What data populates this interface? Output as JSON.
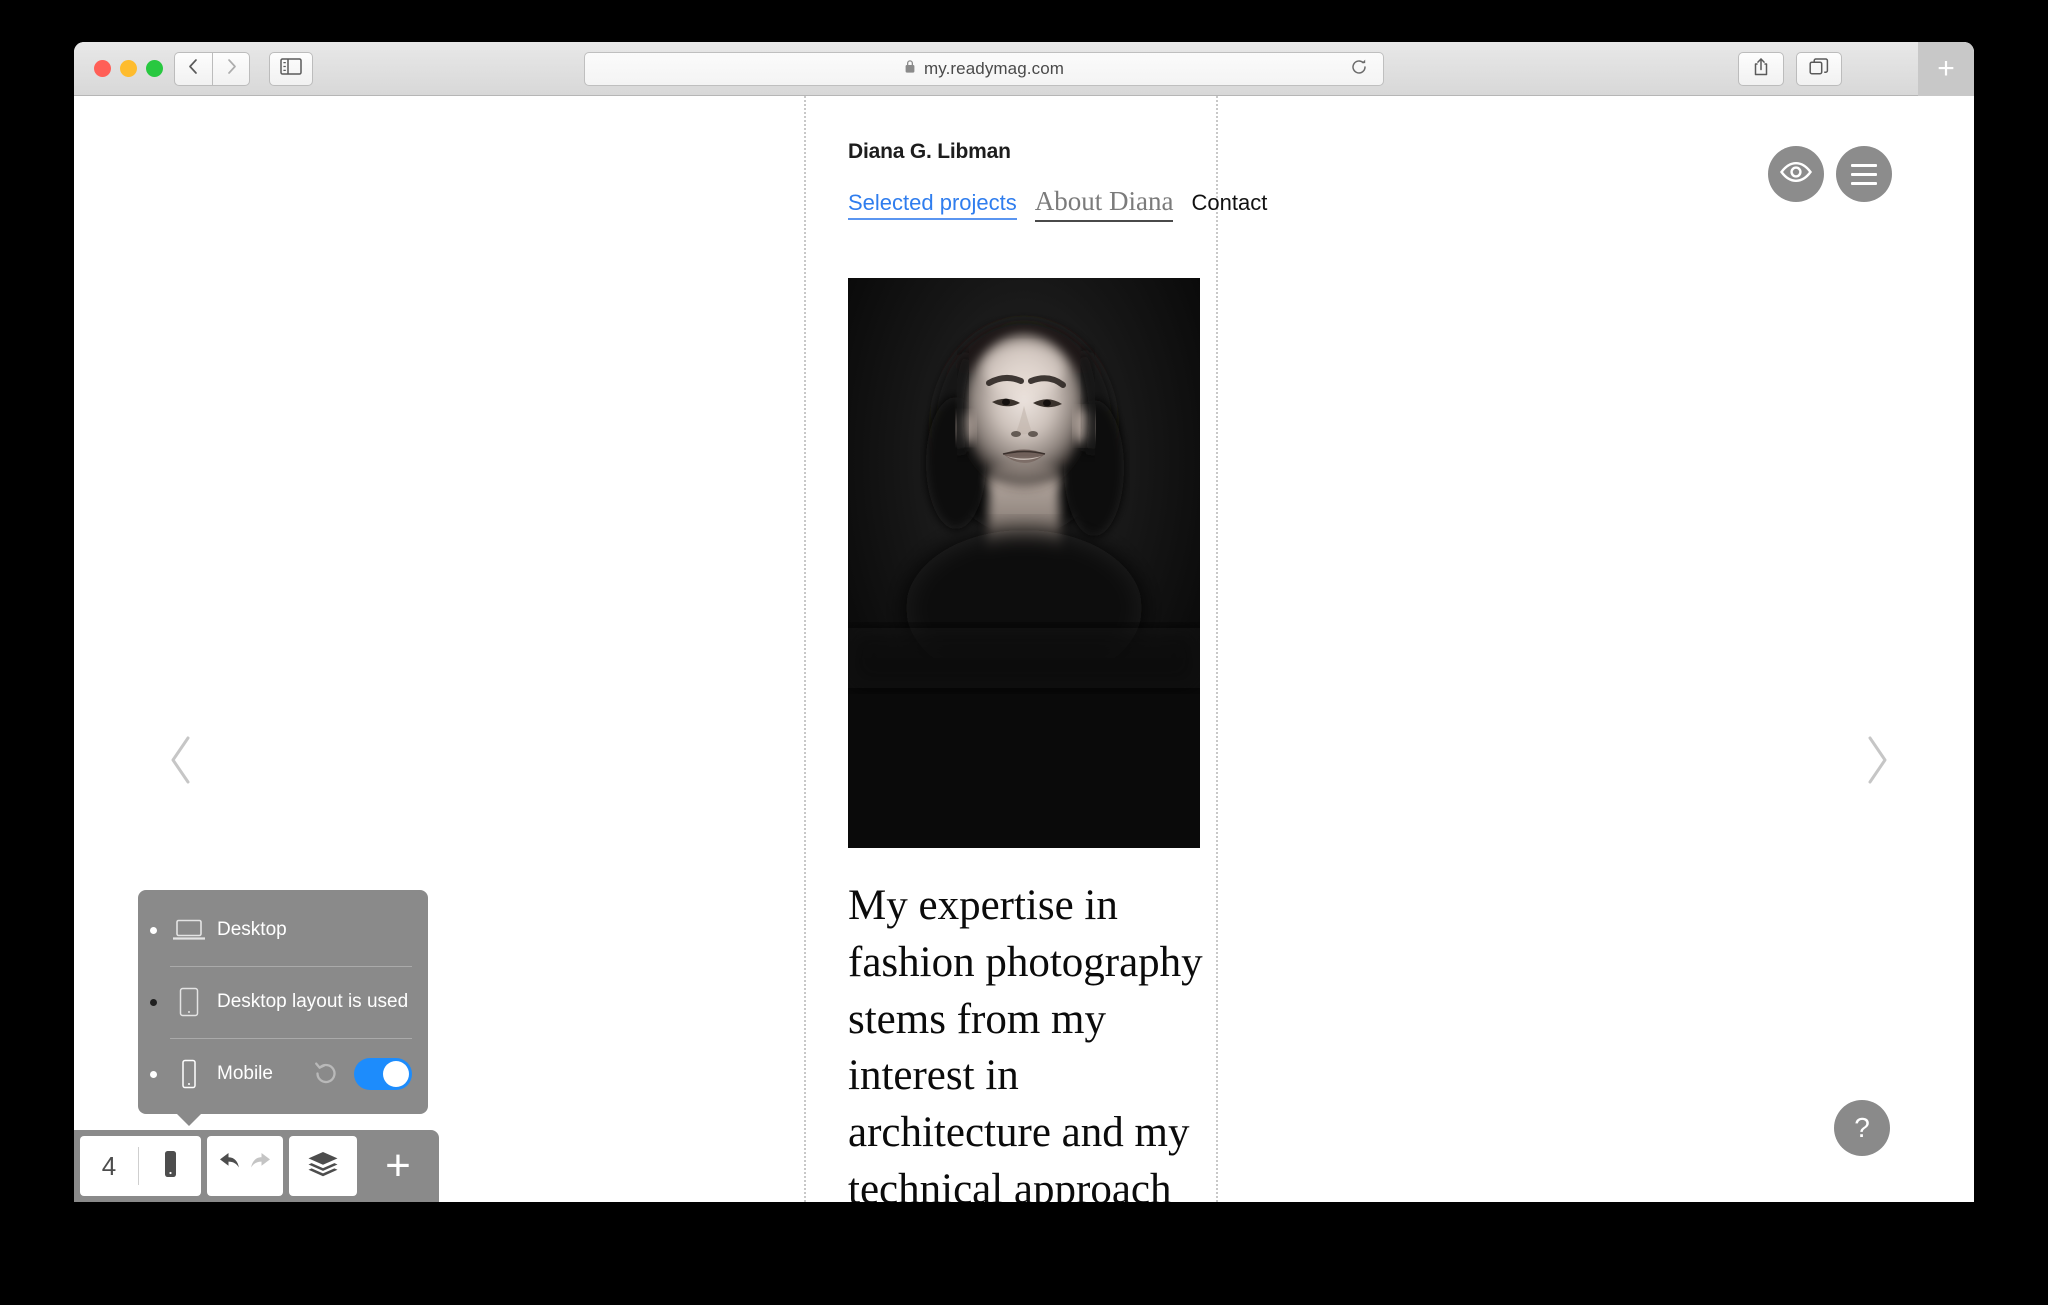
{
  "browser": {
    "url": "my.readymag.com",
    "lock_icon": "lock-icon",
    "back_icon": "chevron-left-icon",
    "forward_icon": "chevron-right-icon",
    "sidebar_icon": "sidebar-toggle-icon",
    "reload_icon": "reload-icon",
    "share_icon": "share-icon",
    "tabs_icon": "tabs-icon",
    "new_tab_label": "+"
  },
  "site": {
    "title": "Diana G. Libman",
    "nav": [
      {
        "label": "Selected projects",
        "state": "link-blue"
      },
      {
        "label": "About Diana",
        "state": "active-serif"
      },
      {
        "label": "Contact",
        "state": "plain"
      }
    ],
    "photo_alt": "portrait-photo",
    "body_text": "My expertise in fashion photography stems from my interest in architecture and my technical approach"
  },
  "canvas": {
    "prev_icon": "chevron-left-icon",
    "next_icon": "chevron-right-icon"
  },
  "floating": {
    "preview_icon": "eye-icon",
    "menu_icon": "hamburger-menu-icon",
    "help_label": "?"
  },
  "device_popover": {
    "rows": [
      {
        "icon": "desktop-icon",
        "label": "Desktop"
      },
      {
        "icon": "tablet-icon",
        "label": "Desktop layout is used"
      },
      {
        "icon": "mobile-icon",
        "label": "Mobile",
        "reset_icon": "reset-arrow-icon",
        "toggle": "on"
      }
    ]
  },
  "bottom_toolbar": {
    "page_count": "4",
    "device_icon": "mobile-icon",
    "undo_icon": "undo-arrow-icon",
    "redo_icon": "redo-arrow-icon",
    "layers_icon": "layers-icon",
    "add_label": "+"
  },
  "colors": {
    "accent_blue": "#2f7dee",
    "toggle_blue": "#1d8cfc",
    "toolbar_gray": "#8a8a8a"
  }
}
